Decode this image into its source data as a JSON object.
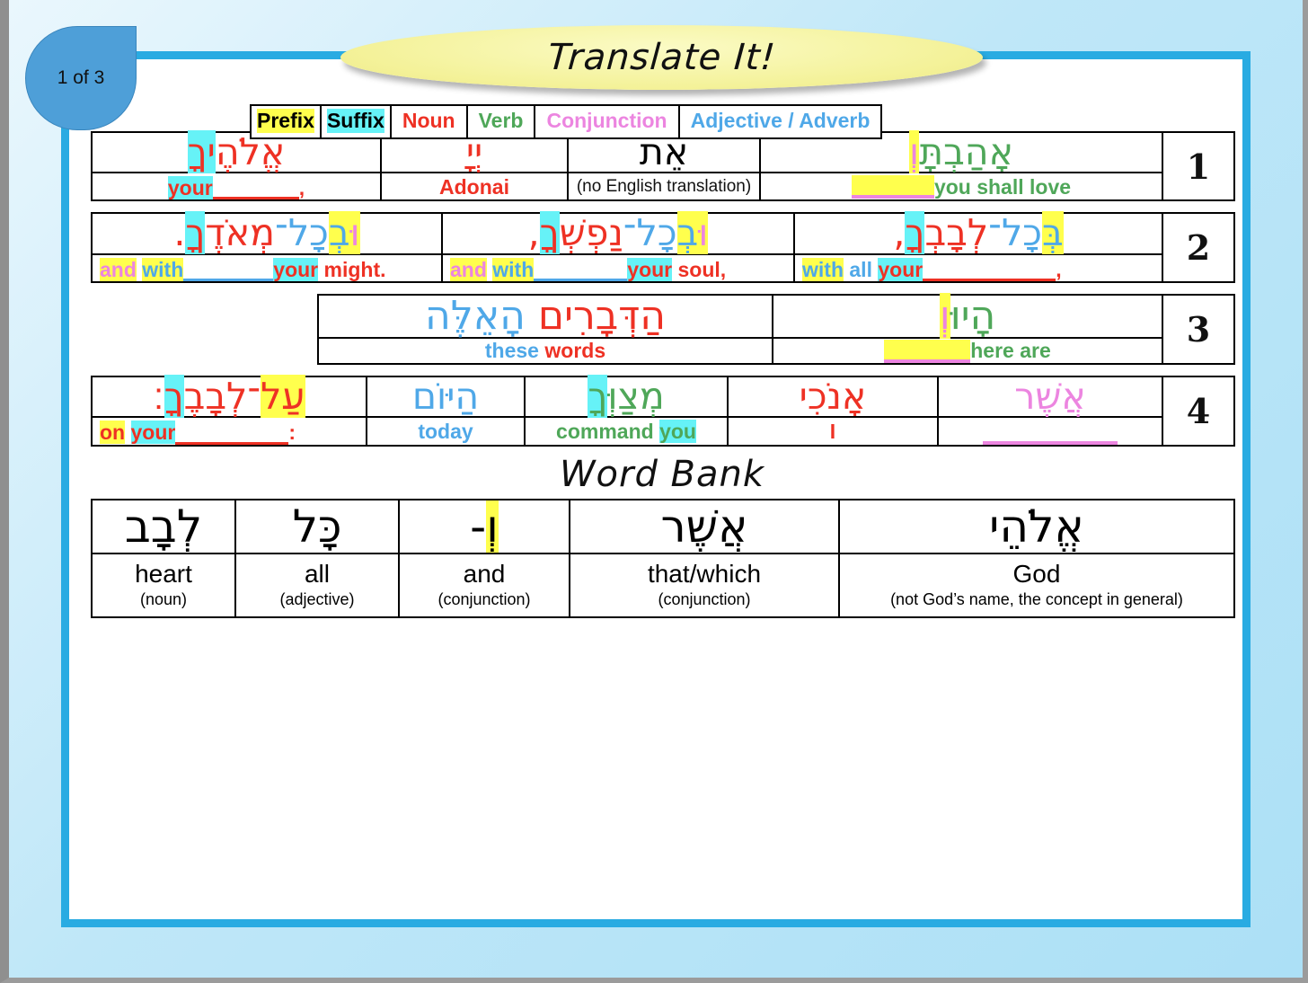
{
  "badge": {
    "label": "1 of 3"
  },
  "title": "Translate It!",
  "legend": {
    "items": [
      {
        "label": "Prefix",
        "style": "prefix"
      },
      {
        "label": "Suffix",
        "style": "suffix"
      },
      {
        "label": "Noun",
        "style": "noun"
      },
      {
        "label": "Verb",
        "style": "verb"
      },
      {
        "label": "Conjunction",
        "style": "conjunction"
      },
      {
        "label": "Adjective / Adverb",
        "style": "adjadv"
      }
    ]
  },
  "colors": {
    "noun": "#ee3124",
    "verb": "#4fa759",
    "conjunction": "#ec85e0",
    "adjective_adverb": "#4fa8e8",
    "prefix_highlight": "#ffff4d",
    "suffix_highlight": "#66f2f7",
    "frame": "#29abe2",
    "badge": "#4e9fd8",
    "title_ellipse": "#f4f29a"
  },
  "rows": [
    {
      "number": "1",
      "cells": [
        {
          "hebrew": "אֱלֹהֶיךָ",
          "english": "your ____,"
        },
        {
          "hebrew": "יְיָ",
          "english": "Adonai"
        },
        {
          "hebrew": "אֵת",
          "english": "(no English translation)"
        },
        {
          "hebrew": "וְאָהַבְתָּ",
          "english": "you shall love"
        }
      ]
    },
    {
      "number": "2",
      "cells": [
        {
          "hebrew": "וּבְכָל־מְאֹדֶךָ.",
          "english": "and with ____ your might."
        },
        {
          "hebrew": "וּבְכָל־נַפְשְׁךָ,",
          "english": "and with ____ your soul,"
        },
        {
          "hebrew": "בְּכָל־לְבָבְךָ,",
          "english": "with all your ____,"
        }
      ]
    },
    {
      "number": "3",
      "cells": [
        {
          "hebrew": "הַדְּבָרִים הָאֵלֶּה",
          "english": "these words"
        },
        {
          "hebrew": "וְהָיוּ",
          "english": "here are"
        }
      ]
    },
    {
      "number": "4",
      "cells": [
        {
          "hebrew": "עַל־לְבָבֶךָ׃",
          "english": "on your ____:"
        },
        {
          "hebrew": "הַיּוֹם",
          "english": "today"
        },
        {
          "hebrew": "מְצַוְּךָ",
          "english": "command you"
        },
        {
          "hebrew": "אָנֹכִי",
          "english": "I"
        },
        {
          "hebrew": "אֲשֶׁר",
          "english": "____"
        }
      ]
    }
  ],
  "word_bank": {
    "title": "Word Bank",
    "entries": [
      {
        "hebrew": "לְבָב",
        "english": "heart",
        "pos": "(noun)"
      },
      {
        "hebrew": "כָּל",
        "english": "all",
        "pos": "(adjective)"
      },
      {
        "hebrew": "וְ-",
        "english": "and",
        "pos": "(conjunction)"
      },
      {
        "hebrew": "אֲשֶׁר",
        "english": "that/which",
        "pos": "(conjunction)"
      },
      {
        "hebrew": "אֱלֹהֵי",
        "english": "God",
        "pos": "(not God’s name, the concept in general)"
      }
    ]
  }
}
